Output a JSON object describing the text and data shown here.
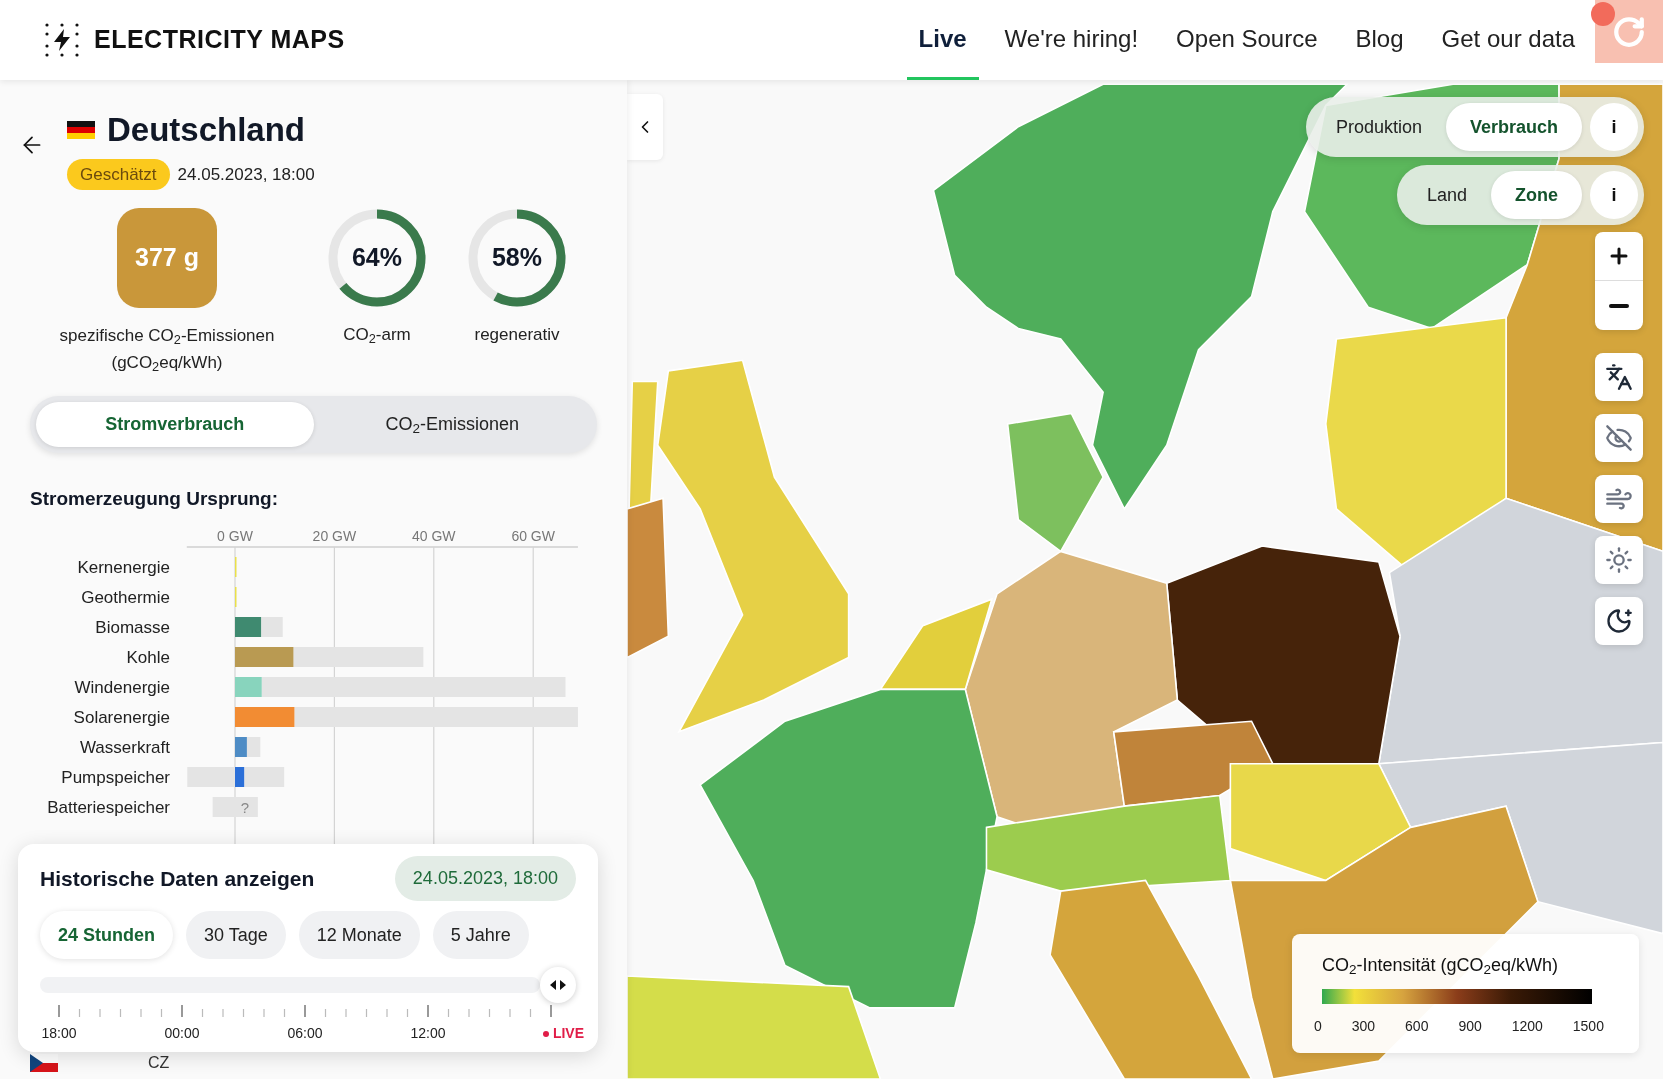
{
  "header": {
    "logo_text": "ELECTRICITY MAPS",
    "nav": [
      {
        "label": "Live",
        "selected": true
      },
      {
        "label": "We're hiring!",
        "selected": false
      },
      {
        "label": "Open Source",
        "selected": false
      },
      {
        "label": "Blog",
        "selected": false
      },
      {
        "label": "Get our data",
        "selected": false
      }
    ]
  },
  "zone": {
    "name": "Deutschland",
    "badge": "Geschätzt",
    "datetime": "24.05.2023, 18:00",
    "intensity": {
      "value": "377 g",
      "color": "#c9973a",
      "label": "spezifische CO$_{2}$-Emissionen (gCO$_{2}$eq/kWh)"
    },
    "rings": [
      {
        "value": "64%",
        "level": 0.64,
        "label": "CO$_{2}$-arm"
      },
      {
        "value": "58%",
        "level": 0.58,
        "label": "regenerativ"
      }
    ],
    "mode_tabs": [
      {
        "label": "Stromverbrauch",
        "selected": true
      },
      {
        "label": "CO$_{2}$-Emissionen",
        "selected": false
      }
    ],
    "section_title": "Stromerzeugung Ursprung:",
    "chart_data": {
      "type": "bar",
      "orientation": "horizontal",
      "stacked": true,
      "grid": true,
      "categories": [
        "Kernenergie",
        "Geothermie",
        "Biomasse",
        "Kohle",
        "Windenergie",
        "Solarenergie",
        "Wasserkraft",
        "Pumpspeicher",
        "Batteriespeicher"
      ],
      "series": [
        {
          "colors": [
            "#e9e04a",
            "#e9e04a",
            "#3f8a70",
            "#b99a52",
            "#88d4bd",
            "#f28c33",
            "#4e8cc5",
            "#2b6fd8",
            null
          ],
          "values": [
            0.2,
            0.2,
            5.3,
            11.8,
            5.4,
            12.0,
            2.4,
            1.9,
            null
          ]
        },
        {
          "color": "#e4e4e4",
          "values": [
            null,
            null,
            4.3,
            26.1,
            61.1,
            57.0,
            2.7,
            8.0,
            4.6
          ]
        },
        {
          "color": "#e4e4e4",
          "values": [
            null,
            null,
            null,
            null,
            null,
            null,
            null,
            -9.6,
            -4.5
          ]
        }
      ],
      "xlim": [
        -9.7,
        69
      ],
      "xticks": [
        {
          "value": 0,
          "label": "0 GW"
        },
        {
          "value": 20,
          "label": "20 GW"
        },
        {
          "value": 40,
          "label": "40 GW"
        },
        {
          "value": 60,
          "label": "60 GW"
        }
      ],
      "annotations": [
        {
          "x": 2,
          "y": "Batteriespeicher",
          "text": "?"
        }
      ]
    },
    "next_row": {
      "label": "CZ"
    }
  },
  "history": {
    "title": "Historische Daten anzeigen",
    "datetime": "24.05.2023, 18:00",
    "ranges": [
      {
        "label": "24 Stunden",
        "selected": true
      },
      {
        "label": "30 Tage",
        "selected": false
      },
      {
        "label": "12 Monate",
        "selected": false
      },
      {
        "label": "5 Jahre",
        "selected": false
      }
    ],
    "slider": {
      "level": 1
    },
    "time_labels": [
      "18:00",
      "00:00",
      "06:00",
      "12:00"
    ],
    "live_label": "LIVE"
  },
  "map": {
    "view_toggle": [
      {
        "label": "Produktion",
        "selected": false
      },
      {
        "label": "Verbrauch",
        "selected": true
      }
    ],
    "view_info": "i",
    "scope_toggle": [
      {
        "label": "Land",
        "selected": false
      },
      {
        "label": "Zone",
        "selected": true
      }
    ],
    "scope_info": "i",
    "legend": {
      "title": "CO$_{2}$-Intensität (gCO$_{2}$eq/kWh)",
      "ticks": [
        "0",
        "300",
        "600",
        "900",
        "1200",
        "1500"
      ]
    }
  }
}
